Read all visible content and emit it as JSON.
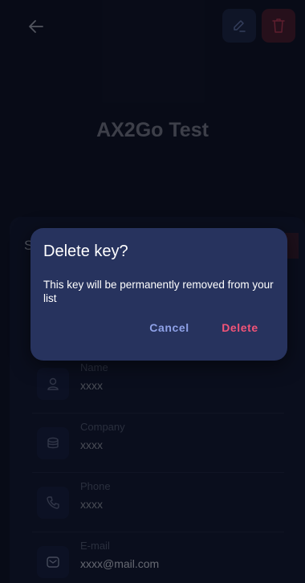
{
  "header": {
    "title": "AX2Go Test",
    "back_icon": "arrow-left-icon",
    "edit_icon": "pencil-icon",
    "delete_icon": "trash-icon"
  },
  "section": {
    "label_partial": "S"
  },
  "fields": [
    {
      "icon": "person-icon",
      "label": "Name",
      "value": "xxxx"
    },
    {
      "icon": "database-icon",
      "label": "Company",
      "value": "xxxx"
    },
    {
      "icon": "phone-icon",
      "label": "Phone",
      "value": "xxxx"
    },
    {
      "icon": "mail-icon",
      "label": "E-mail",
      "value": "xxxx@mail.com"
    }
  ],
  "dialog": {
    "title": "Delete key?",
    "message": "This key will be permanently removed from your list",
    "cancel_label": "Cancel",
    "delete_label": "Delete"
  },
  "colors": {
    "background": "#0c0f1d",
    "dialog": "#27335e",
    "cancel": "#8fa2e8",
    "delete": "#f25478"
  }
}
